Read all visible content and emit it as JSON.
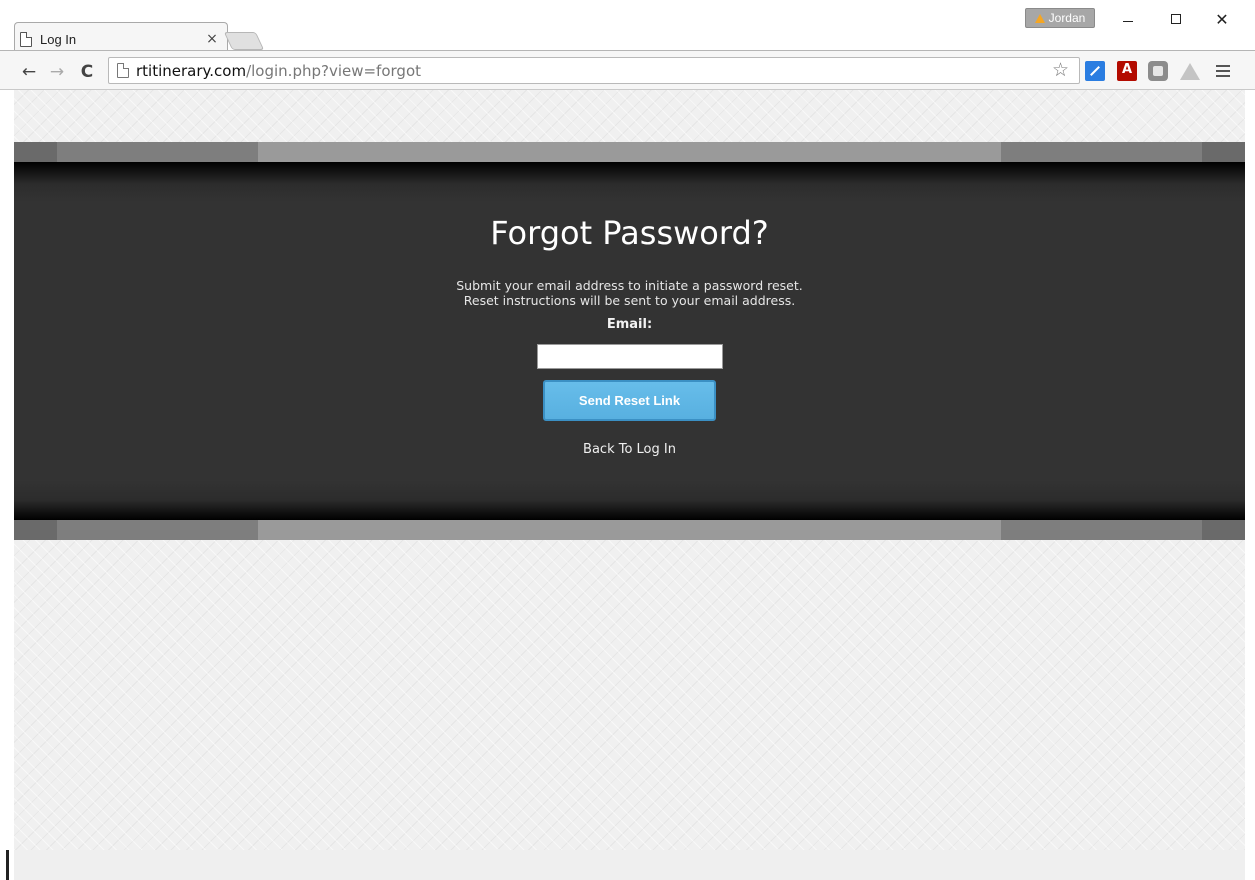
{
  "browser": {
    "tab_title": "Log In",
    "tab_close": "×",
    "profile_name": "Jordan",
    "url_domain": "rtitinerary.com",
    "url_path": "/login.php?view=forgot",
    "window_close": "✕",
    "nav": {
      "back": "←",
      "forward": "→",
      "reload": "C"
    },
    "star": "☆"
  },
  "icons": {
    "page": "page-icon",
    "warning": "warning-icon",
    "extensions": [
      "extension-share-icon",
      "adobe-acrobat-icon",
      "extension-box-icon",
      "google-drive-icon"
    ],
    "menu": "hamburger-menu-icon"
  },
  "form": {
    "title": "Forgot Password?",
    "description_line1": "Submit your email address to initiate a password reset.",
    "description_line2": "Reset instructions will be sent to your email address.",
    "email_label": "Email:",
    "email_value": "",
    "submit_label": "Send Reset Link",
    "back_link": "Back To Log In"
  },
  "colors": {
    "panel_bg": "#333333",
    "button_bg": "#5fb7e5",
    "button_border": "#3b90c4",
    "page_bg": "#f0f0f0"
  }
}
